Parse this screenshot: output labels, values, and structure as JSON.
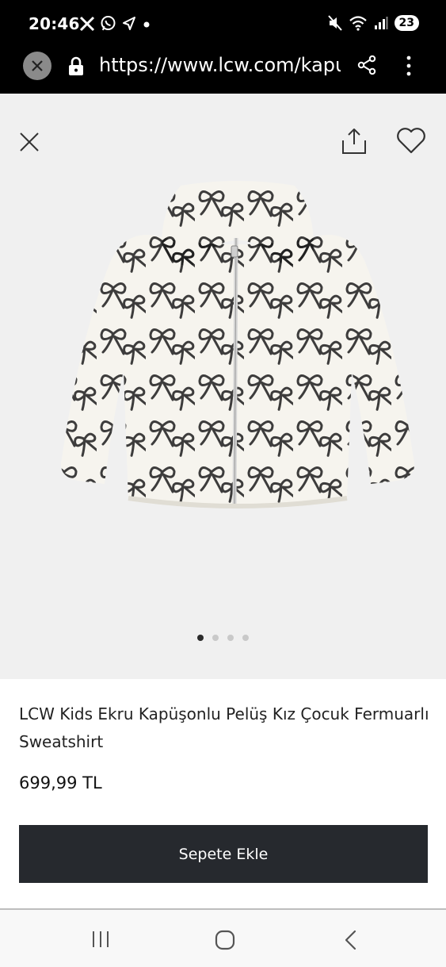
{
  "status_bar": {
    "time": "20:46",
    "battery": "23",
    "icons": [
      "x-app-icon",
      "whatsapp-icon",
      "location-icon",
      "notification-dot",
      "mute-icon",
      "wifi-icon",
      "signal-icon"
    ]
  },
  "browser": {
    "url": "https://www.lcw.com/kapusc",
    "icons": [
      "close-icon",
      "lock-icon",
      "share-icon",
      "more-vertical-icon"
    ]
  },
  "product": {
    "title": "LCW Kids Ekru Kapüşonlu Pelüş Kız Çocuk Fermuarlı Sweatshirt",
    "price": "699,99 TL",
    "image_count": 4,
    "active_image": 1,
    "image_icons": [
      "close-icon",
      "share-icon",
      "heart-icon"
    ]
  },
  "actions": {
    "add_to_cart_label": "Sepete Ekle"
  },
  "colors": {
    "button_bg": "#26292e",
    "image_bg": "#f0f0f0",
    "bar_bg": "#000000"
  }
}
